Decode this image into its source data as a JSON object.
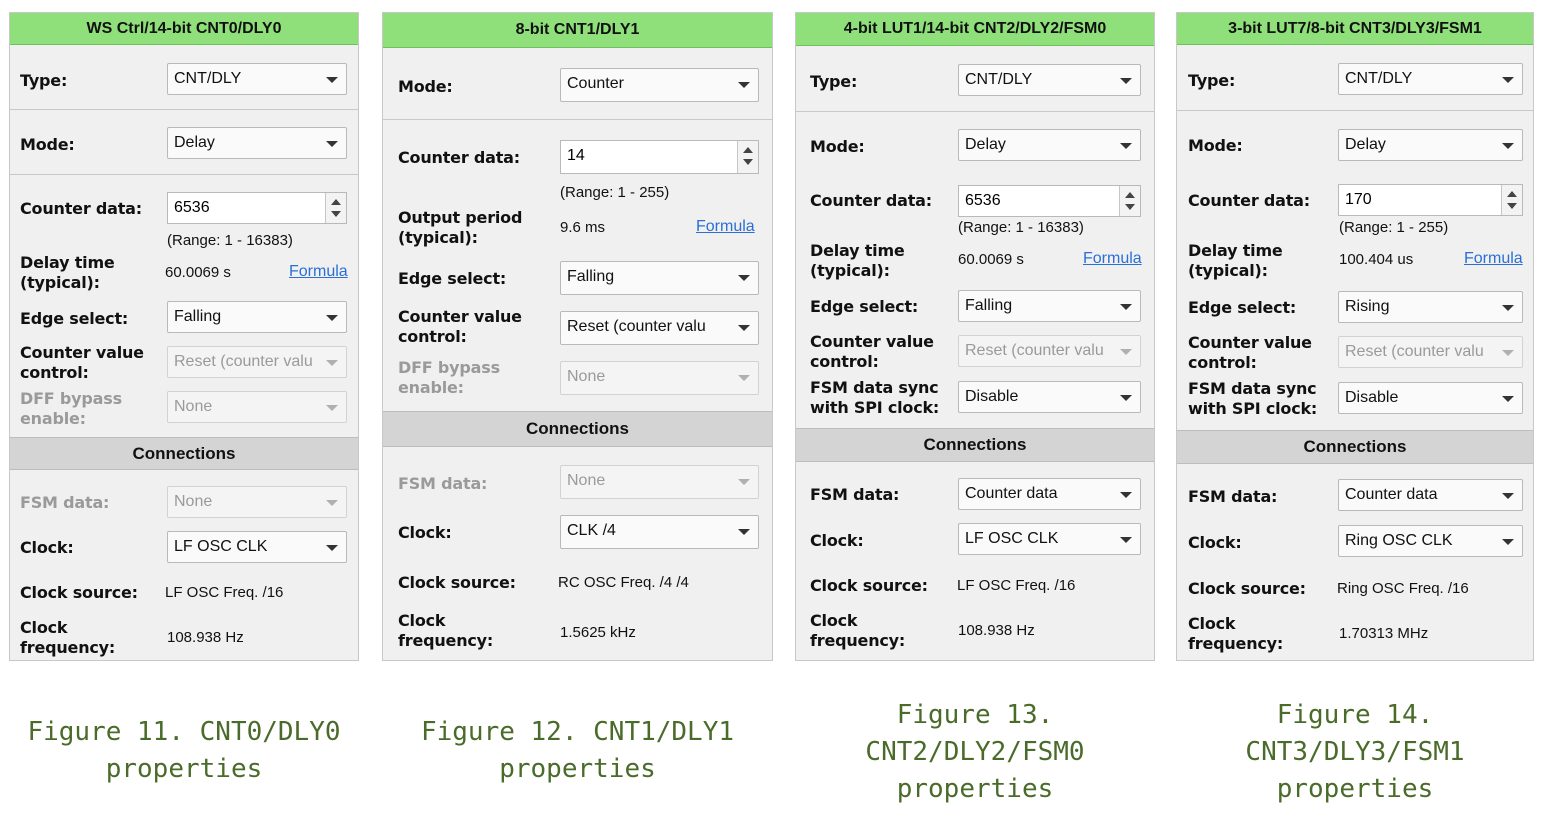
{
  "panels": [
    {
      "title": "WS Ctrl/14-bit CNT0/DLY0",
      "type_label": "Type:",
      "type_value": "CNT/DLY",
      "mode_label": "Mode:",
      "mode_value": "Delay",
      "counter_label": "Counter data:",
      "counter_value": "6536",
      "range": "(Range:  1 - 16383)",
      "delay_label_1": "Delay time",
      "delay_label_2": "(typical):",
      "delay_value": "60.0069 s",
      "formula": "Formula",
      "edge_label": "Edge select:",
      "edge_value": "Falling",
      "cvc_label_1": "Counter value",
      "cvc_label_2": "control:",
      "cvc_value": "Reset (counter valu",
      "dff_label_1": "DFF bypass",
      "dff_label_2": "enable:",
      "dff_value": "None",
      "connections": "Connections",
      "fsm_label": "FSM data:",
      "fsm_value": "None",
      "clock_label": "Clock:",
      "clock_value": "LF OSC CLK",
      "source_label": "Clock source:",
      "source_value": "LF OSC Freq. /16",
      "freq_label_1": "Clock",
      "freq_label_2": "frequency:",
      "freq_value": "108.938 Hz"
    },
    {
      "title": "8-bit CNT1/DLY1",
      "mode_label": "Mode:",
      "mode_value": "Counter",
      "counter_label": "Counter data:",
      "counter_value": "14",
      "range": "(Range:  1 - 255)",
      "output_label_1": "Output period",
      "output_label_2": "(typical):",
      "output_value": "9.6 ms",
      "formula": "Formula",
      "edge_label": "Edge select:",
      "edge_value": "Falling",
      "cvc_label_1": "Counter value",
      "cvc_label_2": "control:",
      "cvc_value": "Reset (counter valu",
      "dff_label_1": "DFF bypass",
      "dff_label_2": "enable:",
      "dff_value": "None",
      "connections": "Connections",
      "fsm_label": "FSM data:",
      "fsm_value": "None",
      "clock_label": "Clock:",
      "clock_value": "CLK /4",
      "source_label": "Clock source:",
      "source_value": "RC OSC Freq. /4 /4",
      "freq_label_1": "Clock",
      "freq_label_2": "frequency:",
      "freq_value": "1.5625 kHz"
    },
    {
      "title": "4-bit LUT1/14-bit CNT2/DLY2/FSM0",
      "type_label": "Type:",
      "type_value": "CNT/DLY",
      "mode_label": "Mode:",
      "mode_value": "Delay",
      "counter_label": "Counter data:",
      "counter_value": "6536",
      "range": "(Range:  1 - 16383)",
      "delay_label_1": "Delay time",
      "delay_label_2": "(typical):",
      "delay_value": "60.0069 s",
      "formula": "Formula",
      "edge_label": "Edge select:",
      "edge_value": "Falling",
      "cvc_label_1": "Counter value",
      "cvc_label_2": "control:",
      "cvc_value": "Reset (counter valu",
      "sync_label_1": "FSM data sync",
      "sync_label_2": "with SPI clock:",
      "sync_value": "Disable",
      "connections": "Connections",
      "fsm_label": "FSM data:",
      "fsm_value": "Counter data",
      "clock_label": "Clock:",
      "clock_value": "LF OSC CLK",
      "source_label": "Clock source:",
      "source_value": "LF OSC Freq. /16",
      "freq_label_1": "Clock",
      "freq_label_2": "frequency:",
      "freq_value": "108.938 Hz"
    },
    {
      "title": "3-bit LUT7/8-bit CNT3/DLY3/FSM1",
      "type_label": "Type:",
      "type_value": "CNT/DLY",
      "mode_label": "Mode:",
      "mode_value": "Delay",
      "counter_label": "Counter data:",
      "counter_value": "170",
      "range": "(Range:  1 - 255)",
      "delay_label_1": "Delay time",
      "delay_label_2": "(typical):",
      "delay_value": "100.404 us",
      "formula": "Formula",
      "edge_label": "Edge select:",
      "edge_value": "Rising",
      "cvc_label_1": "Counter value",
      "cvc_label_2": "control:",
      "cvc_value": "Reset (counter valu",
      "sync_label_1": "FSM data sync",
      "sync_label_2": "with SPI clock:",
      "sync_value": "Disable",
      "connections": "Connections",
      "fsm_label": "FSM data:",
      "fsm_value": "Counter data",
      "clock_label": "Clock:",
      "clock_value": "Ring OSC CLK",
      "source_label": "Clock source:",
      "source_value": "Ring OSC Freq. /16",
      "freq_label_1": "Clock",
      "freq_label_2": "frequency:",
      "freq_value": "1.70313 MHz"
    }
  ],
  "captions": [
    [
      "Figure 11. CNT0/DLY0",
      "properties"
    ],
    [
      "Figure 12. CNT1/DLY1",
      "properties"
    ],
    [
      "Figure 13.",
      "CNT2/DLY2/FSM0",
      "properties"
    ],
    [
      "Figure 14.",
      "CNT3/DLY3/FSM1",
      "properties"
    ]
  ],
  "colors": {
    "title_bar": "#8fe07a",
    "caption": "#4a6b2a",
    "link": "#2a6fd6"
  }
}
